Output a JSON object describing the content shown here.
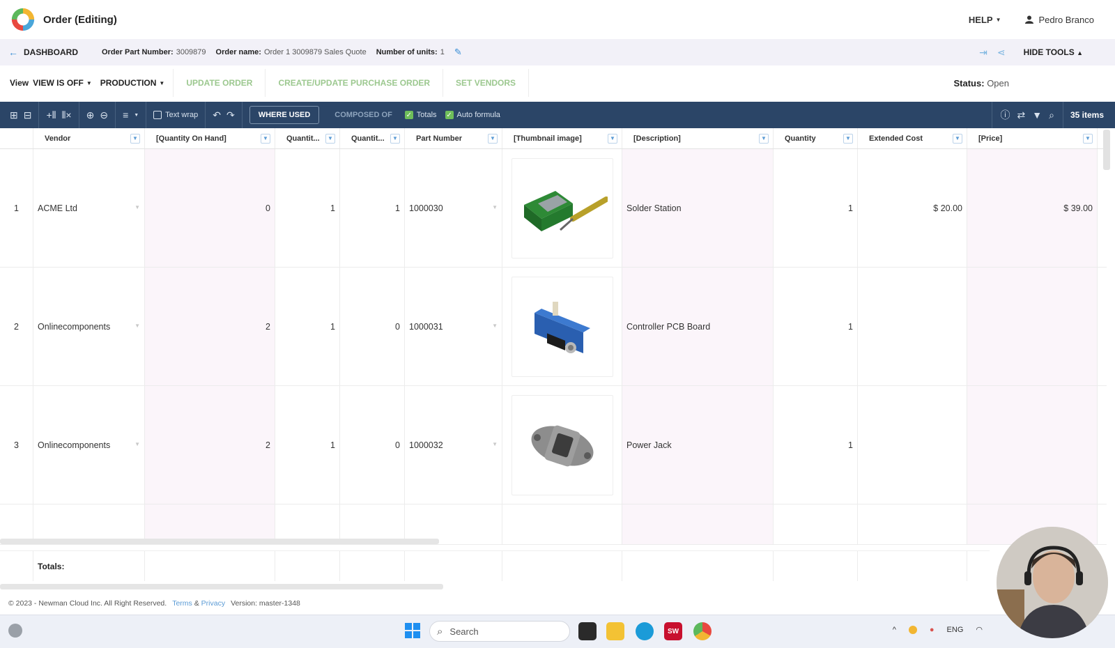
{
  "header": {
    "title": "Order (Editing)",
    "help": "HELP",
    "user": "Pedro Branco"
  },
  "infobar": {
    "back_label": "DASHBOARD",
    "order_part_number_label": "Order Part Number:",
    "order_part_number": "3009879",
    "order_name_label": "Order name:",
    "order_name": "Order 1 3009879 Sales Quote",
    "units_label": "Number of units:",
    "units": "1",
    "hide_tools": "HIDE TOOLS"
  },
  "actionbar": {
    "view_label": "View",
    "view_mode": "VIEW IS OFF",
    "production": "PRODUCTION",
    "update_order": "UPDATE ORDER",
    "purchase_order": "CREATE/UPDATE PURCHASE ORDER",
    "set_vendors": "SET VENDORS",
    "status_label": "Status:",
    "status_value": "Open"
  },
  "toolbar": {
    "text_wrap": "Text wrap",
    "where_used": "WHERE USED",
    "composed_of": "COMPOSED OF",
    "totals": "Totals",
    "auto_formula": "Auto formula",
    "items_count": "35 items"
  },
  "grid": {
    "columns": [
      "Vendor",
      "[Quantity On Hand]",
      "Quantit...",
      "Quantit...",
      "Part Number",
      "[Thumbnail image]",
      "[Description]",
      "Quantity",
      "Extended Cost",
      "[Price]"
    ],
    "rows": [
      {
        "idx": "1",
        "vendor": "ACME Ltd",
        "qoh": "0",
        "q1": "1",
        "q2": "1",
        "part": "1000030",
        "thumb": "solder-station",
        "desc": "Solder Station",
        "qty": "1",
        "ext": "$ 20.00",
        "price": "$ 39.00"
      },
      {
        "idx": "2",
        "vendor": "Onlinecomponents",
        "qoh": "2",
        "q1": "1",
        "q2": "0",
        "part": "1000031",
        "thumb": "pcb-board",
        "desc": "Controller PCB Board",
        "qty": "1",
        "ext": "",
        "price": ""
      },
      {
        "idx": "3",
        "vendor": "Onlinecomponents",
        "qoh": "2",
        "q1": "1",
        "q2": "0",
        "part": "1000032",
        "thumb": "power-jack",
        "desc": "Power Jack",
        "qty": "1",
        "ext": "",
        "price": ""
      }
    ],
    "totals_label": "Totals:"
  },
  "footer": {
    "copyright": "© 2023 - Newman Cloud Inc. All Right Reserved.",
    "terms": "Terms",
    "amp": "&",
    "privacy": "Privacy",
    "version": "Version: master-1348"
  },
  "taskbar": {
    "search": "Search",
    "lang": "ENG"
  },
  "colors": {
    "toolbar_bg": "#2b4567",
    "accent_green": "#9cc88f",
    "link_blue": "#5b9bd5",
    "row_pink": "#fbf5fa"
  }
}
